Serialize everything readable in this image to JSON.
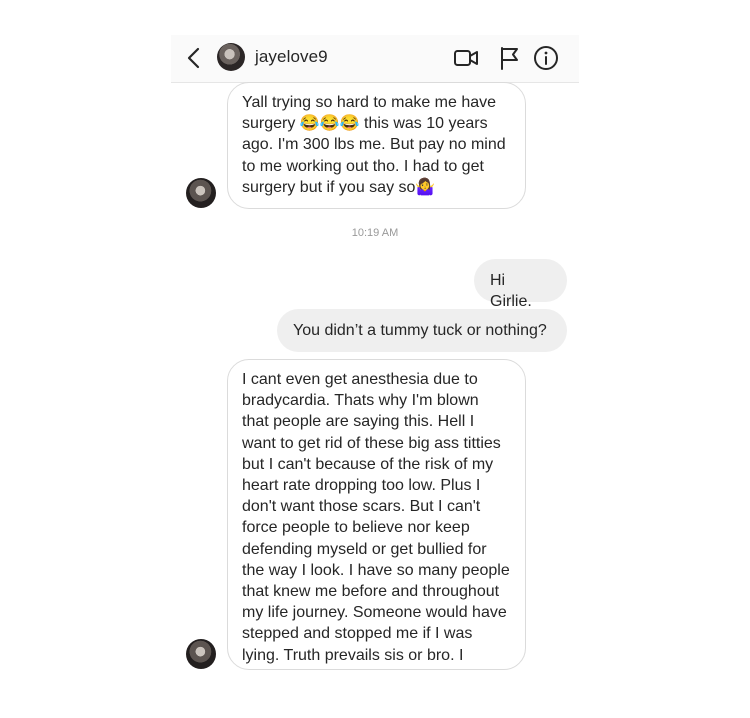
{
  "header": {
    "username": "jayelove9",
    "icons": [
      "back-icon",
      "profile-avatar",
      "video-call-icon",
      "flag-icon",
      "info-icon"
    ]
  },
  "messages": {
    "msg1": "Yall trying so hard to make me have\nsurgery 😂😂😂 this was 10 years\nago. I'm 300 lbs me. But pay no mind\nto me working out tho. I had to get\nsurgery but if you say so🤷‍♀️",
    "timestamp": "10:19 AM",
    "msg2": "Hi Girlie.",
    "msg3": "You didn’t a tummy tuck or nothing?",
    "msg4": "I cant even get anesthesia due to\nbradycardia. Thats why I'm blown\nthat people are saying this. Hell I\nwant to get rid of these big ass titties\nbut I can't because of the risk of my\nheart rate dropping too low. Plus I\ndon't want those scars. But I can't\nforce people to believe nor keep\ndefending myseld or get bullied for\nthe way I look. I have so many people\nthat knew me before and throughout\nmy life journey. Someone would have\nstepped and stopped me if I was\nlying. Truth prevails sis or bro. I"
  },
  "colors": {
    "header_bg": "#fafafa",
    "incoming_bubble_border": "#dbdbdb",
    "outgoing_bubble_bg": "#efefef",
    "text": "#262626",
    "timestamp": "#999999"
  }
}
